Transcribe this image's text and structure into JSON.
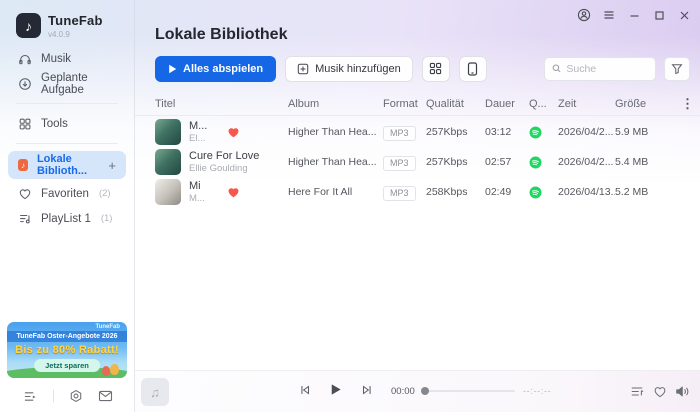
{
  "app": {
    "name": "TuneFab",
    "version": "v4.0.9"
  },
  "icons": {
    "logo_note": "♪",
    "library_note": "♪",
    "placeholder_note": "♫",
    "more_vertical": "⋮",
    "add_plus": "+"
  },
  "sidebar": {
    "items": [
      {
        "label": "Musik"
      },
      {
        "label": "Geplante Aufgabe"
      },
      {
        "label": "Tools"
      },
      {
        "label": "Lokale Biblioth...",
        "selected": true
      },
      {
        "label": "Favoriten",
        "count": "(2)"
      },
      {
        "label": "PlayList 1",
        "count": "(1)"
      }
    ],
    "promo": {
      "brand": "TuneFab",
      "headline": "TuneFab Oster-Angebote 2026",
      "offer": "Bis zu 80% Rabatt!",
      "cta": "Jetzt sparen"
    }
  },
  "header": {
    "title": "Lokale Bibliothek",
    "play_all_label": "Alles abspielen",
    "add_music_label": "Musik hinzufügen",
    "search_placeholder": "Suche"
  },
  "table": {
    "columns": {
      "title": "Titel",
      "album": "Album",
      "format": "Format",
      "quality": "Qualität",
      "duration": "Dauer",
      "source": "Q...",
      "time": "Zeit",
      "size": "Größe"
    },
    "rows": [
      {
        "title": "M...",
        "artist": "El...",
        "favorite": true,
        "album": "Higher Than Hea...",
        "format": "MP3",
        "quality": "257Kbps",
        "duration": "03:12",
        "source": "spotify",
        "date": "2026/04/2...",
        "size": "5.9 MB"
      },
      {
        "title": "Cure For Love",
        "artist": "Ellie Goulding",
        "favorite": false,
        "album": "Higher Than Hea...",
        "format": "MP3",
        "quality": "257Kbps",
        "duration": "02:57",
        "source": "spotify",
        "date": "2026/04/2...",
        "size": "5.4 MB"
      },
      {
        "title": "Mi",
        "artist": "M...",
        "favorite": true,
        "album": "Here For It All",
        "format": "MP3",
        "quality": "258Kbps",
        "duration": "02:49",
        "source": "spotify",
        "date": "2026/04/13...",
        "size": "5.2 MB"
      }
    ]
  },
  "player": {
    "elapsed": "00:00",
    "total": "--:--:--"
  },
  "colors": {
    "accent": "#1567e6",
    "selected_bg": "#d5e6fb",
    "favorite_red": "#f7564d",
    "source_green": "#1ed760",
    "offer_yellow": "#ffd83a"
  }
}
